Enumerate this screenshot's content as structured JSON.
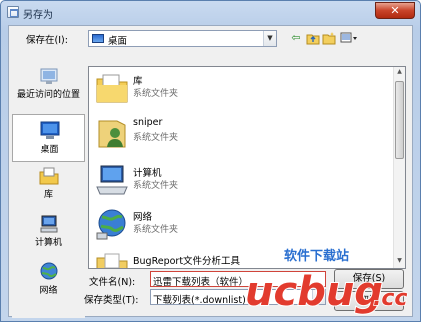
{
  "window": {
    "title": "另存为",
    "close_symbol": "✕"
  },
  "toolbar": {
    "save_in_label": "保存在(I):",
    "location_value": "桌面",
    "back_icon": "back-arrow-icon",
    "up_icon": "up-folder-icon",
    "new_folder_icon": "new-folder-icon",
    "views_icon": "views-menu-icon"
  },
  "places": [
    {
      "label": "最近访问的位置",
      "icon": "recent-places-icon"
    },
    {
      "label": "桌面",
      "icon": "desktop-icon",
      "selected": true
    },
    {
      "label": "库",
      "icon": "libraries-icon"
    },
    {
      "label": "计算机",
      "icon": "computer-icon"
    },
    {
      "label": "网络",
      "icon": "network-icon"
    }
  ],
  "files": [
    {
      "name": "库",
      "type": "系统文件夹",
      "icon": "libraries-folder-icon"
    },
    {
      "name": "sniper",
      "type": "系统文件夹",
      "icon": "user-folder-icon"
    },
    {
      "name": "计算机",
      "type": "系统文件夹",
      "icon": "computer-icon"
    },
    {
      "name": "网络",
      "type": "系统文件夹",
      "icon": "network-globe-icon"
    },
    {
      "name": "BugReport文件分析工具",
      "type": "文件夹",
      "icon": "folder-icon"
    }
  ],
  "form": {
    "filename_label": "文件名(N):",
    "filename_value": "迅雷下载列表（软件）",
    "filetype_label": "保存类型(T):",
    "filetype_value": "下载列表(*.downlist)",
    "save_button": "保存(S)",
    "cancel_button": "取消"
  },
  "watermark": {
    "text_top": "软件下载站",
    "text_logo": "ucbug.cc"
  }
}
